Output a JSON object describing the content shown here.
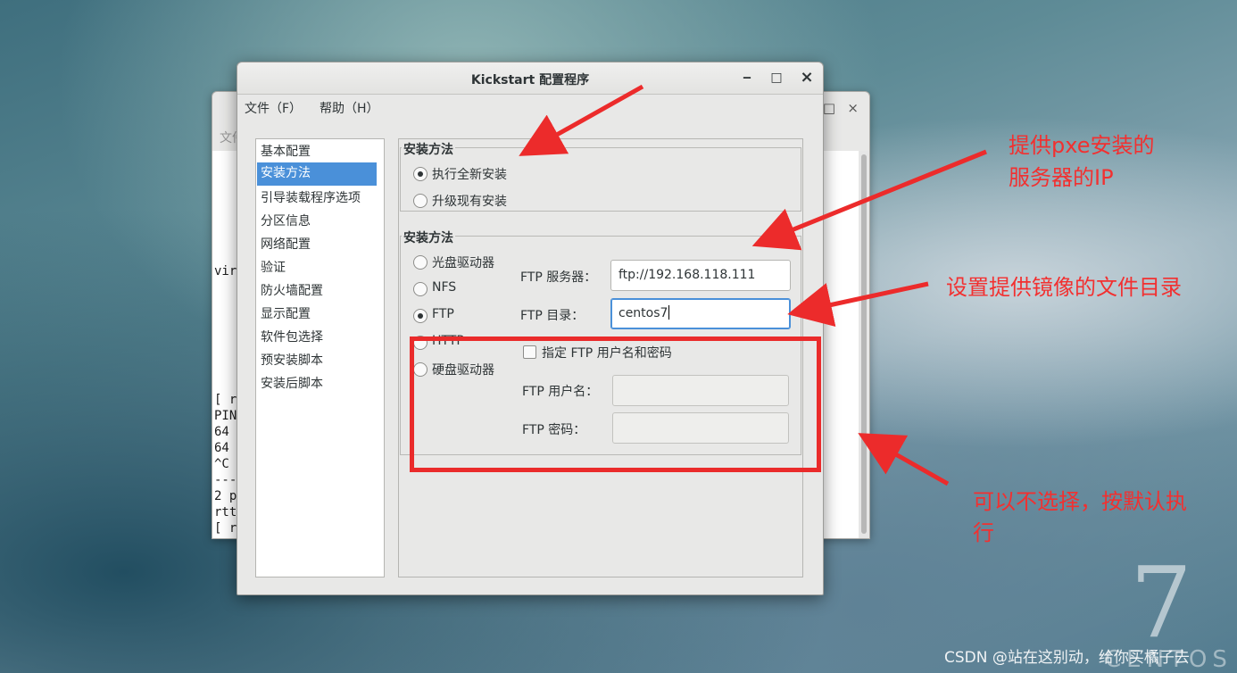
{
  "background_window": {
    "menu_fragment": "文件",
    "terminal_lines": [
      "vir",
      "[ ro",
      "PIN",
      "64",
      "64",
      "^C",
      "---",
      "2 p",
      "rtt",
      "[ ro"
    ]
  },
  "dialog": {
    "title": "Kickstart 配置程序",
    "window_buttons": {
      "minimize": "‒",
      "maximize": "□",
      "close": "×"
    },
    "menu": {
      "file": "文件（F）",
      "help": "帮助（H）"
    },
    "sidebar": {
      "items": [
        "基本配置",
        "安装方法",
        "引导装载程序选项",
        "分区信息",
        "网络配置",
        "验证",
        "防火墙配置",
        "显示配置",
        "软件包选择",
        "预安装脚本",
        "安装后脚本"
      ],
      "selected": "安装方法"
    },
    "install_type": {
      "label": "安装方法",
      "options": [
        "执行全新安装",
        "升级现有安装"
      ],
      "selected": "执行全新安装"
    },
    "install_method": {
      "label": "安装方法",
      "options": [
        "光盘驱动器",
        "NFS",
        "FTP",
        "HTTP",
        "硬盘驱动器"
      ],
      "selected": "FTP",
      "ftp_server_label": "FTP 服务器：",
      "ftp_server_value": "ftp://192.168.118.111",
      "ftp_dir_label": "FTP 目录：",
      "ftp_dir_value": "centos7",
      "specify_credentials_label": "指定  FTP 用户名和密码",
      "specify_credentials_checked": false,
      "ftp_user_label": "FTP 用户名：",
      "ftp_user_value": "",
      "ftp_password_label": "FTP 密码：",
      "ftp_password_value": ""
    }
  },
  "annotations": {
    "server_ip_note": [
      "提供pxe安装的",
      "服务器的IP"
    ],
    "dir_note": "设置提供镜像的文件目录",
    "optional_note": [
      "可以不选择，按默认执",
      "行"
    ],
    "color": "#f23030"
  },
  "desktop": {
    "watermark": "CSDN @站在这别动，给你买橘子去",
    "logo_number": "7",
    "logo_text": "CENTOS"
  }
}
